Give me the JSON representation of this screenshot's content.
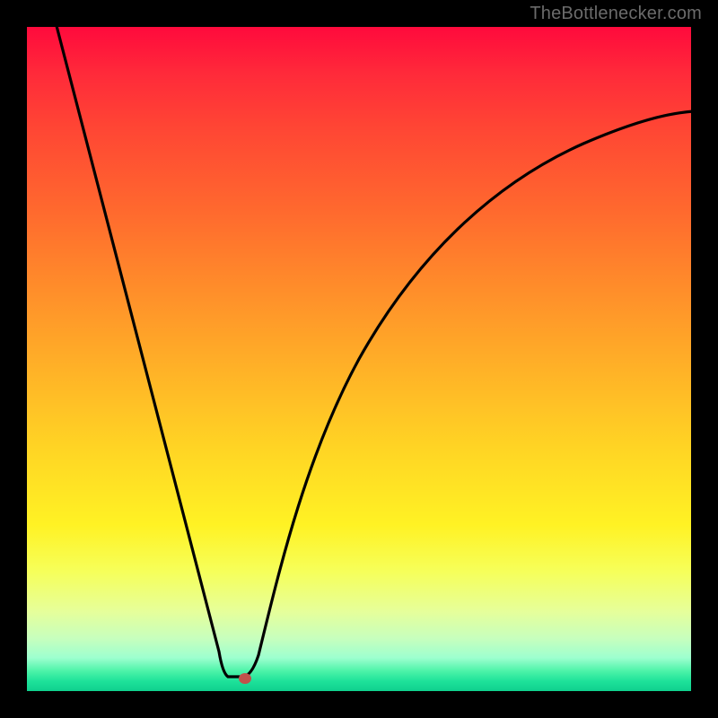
{
  "attribution": "TheBottlenecker.com",
  "chart_data": {
    "type": "line",
    "title": "",
    "xlabel": "",
    "ylabel": "",
    "xlim": [
      0,
      100
    ],
    "ylim": [
      0,
      100
    ],
    "x": [
      0,
      5,
      10,
      15,
      20,
      25,
      28,
      29,
      30,
      31,
      32,
      34,
      38,
      44,
      52,
      60,
      70,
      80,
      90,
      100
    ],
    "values": [
      100,
      84,
      68,
      52,
      36,
      20,
      6,
      2,
      0,
      0,
      4,
      14,
      28,
      42,
      55,
      63,
      71,
      76,
      79,
      81
    ],
    "minimum_point": {
      "x": 30,
      "y": 0
    },
    "background_gradient": {
      "top": "#ff0a3c",
      "mid": "#ffd624",
      "bottom": "#0fd08e"
    },
    "marker_color": "#c1524b"
  }
}
